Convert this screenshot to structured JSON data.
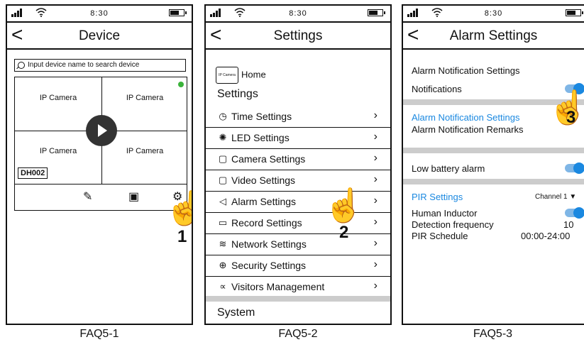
{
  "status": {
    "time": "8:30"
  },
  "p1": {
    "title": "Device",
    "search_placeholder": "Input device name to search device",
    "cells": [
      "IP Camera",
      "IP Camera",
      "IP Camera",
      "IP Camera"
    ],
    "device_tag": "DH002",
    "step": "1",
    "caption": "FAQ5-1",
    "toolbar_icons": [
      "edit-icon",
      "playback-icon",
      "settings-gear-icon"
    ]
  },
  "p2": {
    "title": "Settings",
    "home_label": "Home",
    "home_icon_text": "IP Camera",
    "section": "Settings",
    "items": [
      {
        "icon": "clock-icon",
        "glyph": "◷",
        "label": "Time Settings"
      },
      {
        "icon": "led-icon",
        "glyph": "✺",
        "label": "LED Settings"
      },
      {
        "icon": "camera-icon",
        "glyph": "▢",
        "label": "Camera Settings"
      },
      {
        "icon": "video-icon",
        "glyph": "▢",
        "label": "Video Settings"
      },
      {
        "icon": "bell-icon",
        "glyph": "◁",
        "label": "Alarm Settings"
      },
      {
        "icon": "record-icon",
        "glyph": "▭",
        "label": "Record Settings"
      },
      {
        "icon": "wifi-icon",
        "glyph": "≋",
        "label": "Network Settings"
      },
      {
        "icon": "shield-icon",
        "glyph": "⊕",
        "label": "Security Settings"
      },
      {
        "icon": "share-icon",
        "glyph": "∝",
        "label": "Visitors Management"
      }
    ],
    "system": "System",
    "step": "2",
    "caption": "FAQ5-2"
  },
  "p3": {
    "title": "Alarm Settings",
    "notif_header": "Alarm Notification Settings",
    "notifications": "Notifications",
    "alarm_notif_link": "Alarm Notification Settings",
    "remarks": "Alarm Notification Remarks",
    "low_battery": "Low battery alarm",
    "pir_link": "PIR Settings",
    "channel": "Channel 1 ▼",
    "human_inductor": "Human Inductor",
    "detection_frequency": "Detection frequency",
    "detection_value": "10",
    "pir_schedule": "PIR Schedule",
    "pir_schedule_value": "00:00-24:00",
    "step": "3",
    "caption": "FAQ5-3"
  }
}
